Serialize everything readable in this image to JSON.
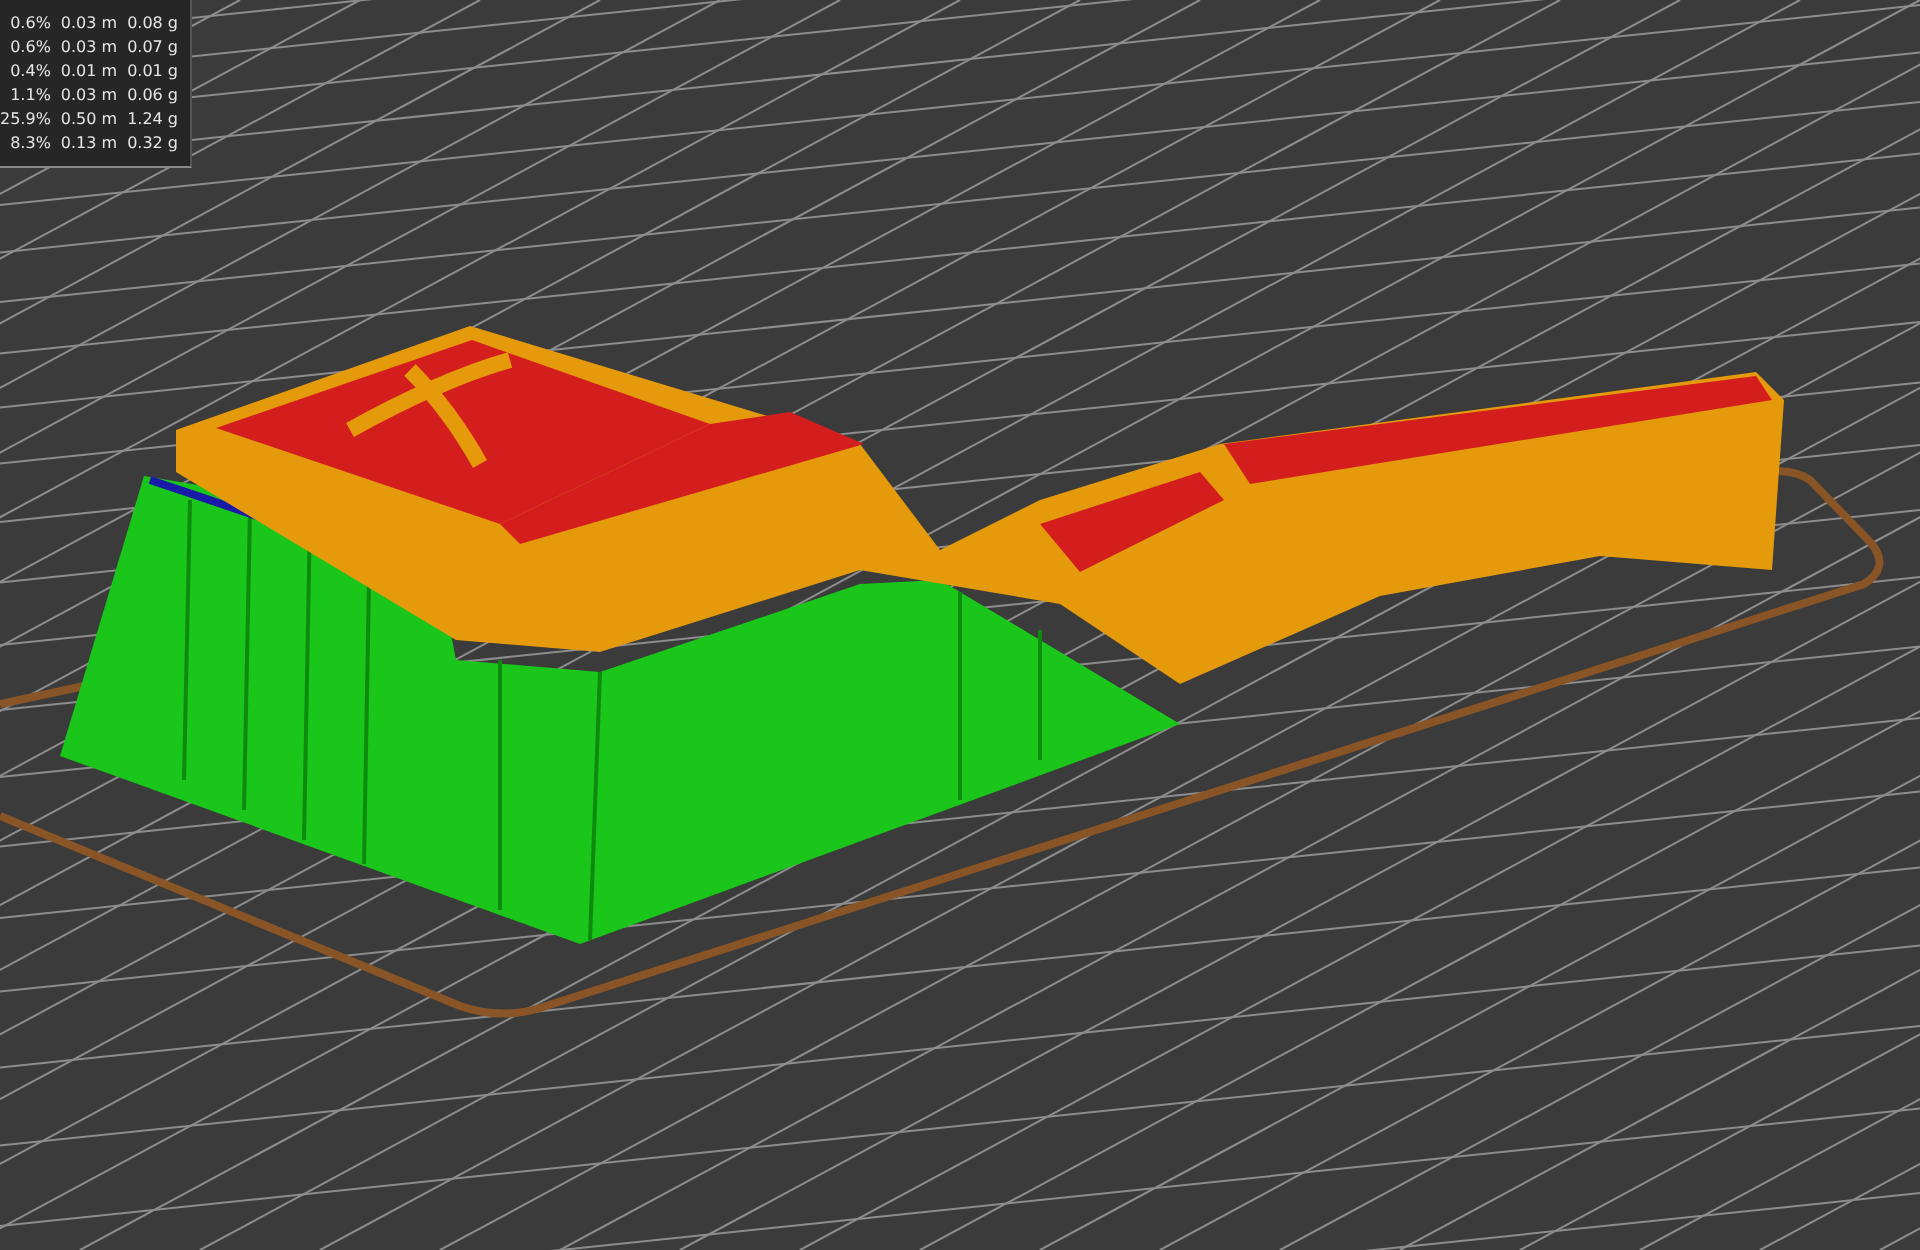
{
  "statistics_panel": {
    "rows": [
      {
        "percent": "0.6%",
        "length": "0.03 m",
        "weight": "0.08 g"
      },
      {
        "percent": "0.6%",
        "length": "0.03 m",
        "weight": "0.07 g"
      },
      {
        "percent": "0.4%",
        "length": "0.01 m",
        "weight": "0.01 g"
      },
      {
        "percent": "1.1%",
        "length": "0.03 m",
        "weight": "0.06 g"
      },
      {
        "percent": "25.9%",
        "length": "0.50 m",
        "weight": "1.24 g"
      },
      {
        "percent": "8.3%",
        "length": "0.13 m",
        "weight": "0.32 g"
      }
    ]
  }
}
